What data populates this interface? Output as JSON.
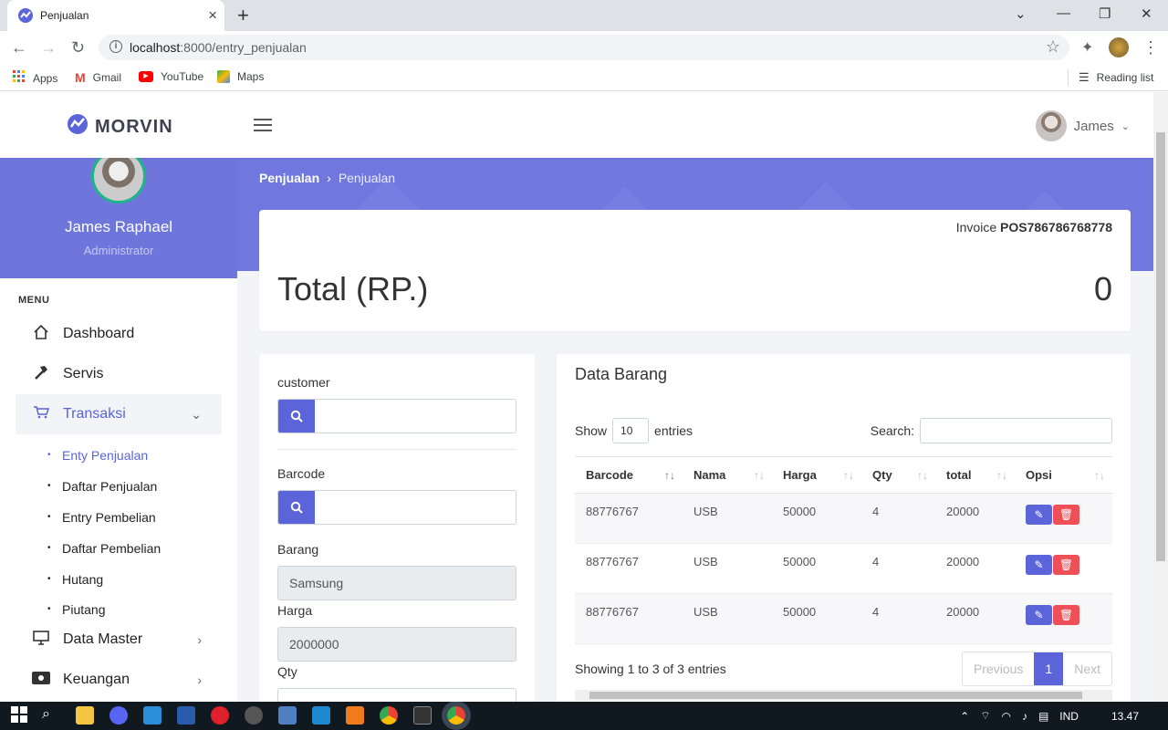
{
  "browser": {
    "tab_title": "Penjualan",
    "url_host": "localhost",
    "url_rest": ":8000/entry_penjualan",
    "bookmarks": [
      "Apps",
      "Gmail",
      "YouTube",
      "Maps"
    ],
    "reading_list": "Reading list"
  },
  "header": {
    "brand": "MORVIN",
    "user_name": "James"
  },
  "sidebar": {
    "name": "James Raphael",
    "role": "Administrator",
    "menu_label": "MENU",
    "items": [
      {
        "label": "Dashboard",
        "icon": "home-icon"
      },
      {
        "label": "Servis",
        "icon": "hammer-icon"
      },
      {
        "label": "Transaksi",
        "icon": "cart-icon"
      },
      {
        "label": "Data Master",
        "icon": "monitor-icon"
      },
      {
        "label": "Keuangan",
        "icon": "money-icon"
      }
    ],
    "sub_items": [
      "Enty Penjualan",
      "Daftar Penjualan",
      "Entry Pembelian",
      "Daftar Pembelian",
      "Hutang",
      "Piutang"
    ]
  },
  "breadcrumb": {
    "parent": "Penjualan",
    "current": "Penjualan"
  },
  "totals": {
    "invoice_label": "Invoice",
    "invoice_no": "POS786786768778",
    "total_label": "Total (RP.)",
    "total_value": "0"
  },
  "form": {
    "customer_label": "customer",
    "barcode_label": "Barcode",
    "barang_label": "Barang",
    "barang_value": "Samsung",
    "harga_label": "Harga",
    "harga_value": "2000000",
    "qty_label": "Qty"
  },
  "table": {
    "title": "Data Barang",
    "show": "Show",
    "entries": "entries",
    "page_len": "10",
    "search_label": "Search:",
    "columns": [
      "Barcode",
      "Nama",
      "Harga",
      "Qty",
      "total",
      "Opsi"
    ],
    "rows": [
      [
        "88776767",
        "USB",
        "50000",
        "4",
        "20000"
      ],
      [
        "88776767",
        "USB",
        "50000",
        "4",
        "20000"
      ],
      [
        "88776767",
        "USB",
        "50000",
        "4",
        "20000"
      ]
    ],
    "info": "Showing 1 to 3 of 3 entries",
    "prev": "Previous",
    "page": "1",
    "next": "Next"
  },
  "taskbar": {
    "lang": "IND",
    "time": "13.47"
  }
}
